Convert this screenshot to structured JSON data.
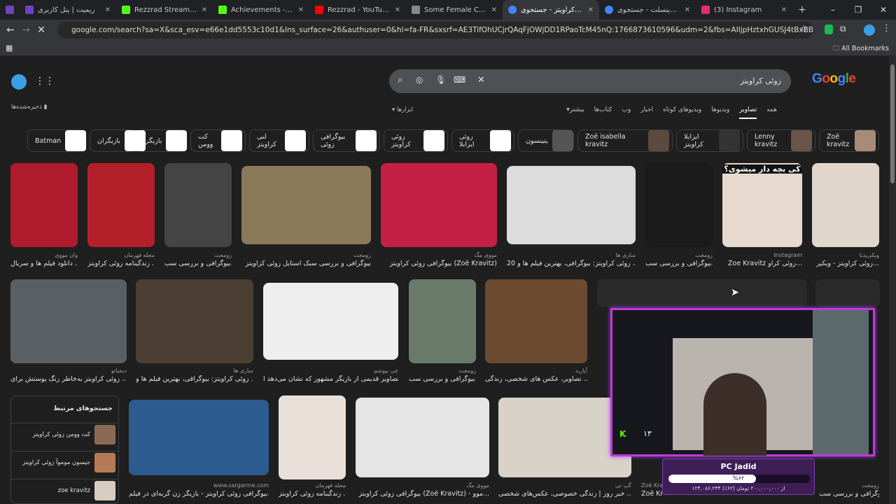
{
  "browser": {
    "tabs": [
      {
        "title": "ریمیت | پنل کاربری",
        "color": "#6f42c1",
        "active": false
      },
      {
        "title": "Rezzrad Stream - Watch L",
        "color": "#53fc18",
        "active": false
      },
      {
        "title": "Achievements - Kick Dash",
        "color": "#53fc18",
        "active": false
      },
      {
        "title": "Rezzrad - YouTube",
        "color": "#ff0000",
        "active": false
      },
      {
        "title": "Some Female Celebs",
        "color": "#888888",
        "active": false
      },
      {
        "title": "زوئی کراویتز - جستجوی",
        "color": "#4285f4",
        "active": true
      },
      {
        "title": "گیت وینسلت - جستجوی",
        "color": "#4285f4",
        "active": false
      },
      {
        "title": "(3) Instagram",
        "color": "#e1306c",
        "active": false
      }
    ],
    "url": "google.com/search?sa=X&sca_esv=e66e1dd5553c10d1&lns_surface=26&authuser=0&hl=fa-FR&sxsrf=AE3TifOhUCjrQAqFjOWjDD1RPaoTcM45nQ:1766873610596&udm=2&fbs=AIIjpHztxhGUSJ4tBxBBheto-n1E44pBQcgqJZ1QfmU35MdQxb2mHW...",
    "all_bookmarks": "All Bookmarks"
  },
  "search": {
    "query": "زوئی کراویتز"
  },
  "saved_label": "ذخیره‌شده‌ها",
  "tools_label": "ابزارها",
  "filters": [
    "همه",
    "تصاویر",
    "ویدیوها",
    "ویدیوهای کوتاه",
    "اخبار",
    "وب",
    "کتاب‌ها",
    "بیشتر"
  ],
  "chips": [
    "Zoë kravitz",
    "Lenny kravitz",
    "ایزابلا کراویتز",
    "Zoë isabella kravitz",
    "پتینسون",
    "زوئی ایزابلا",
    "زوئی کراویتز",
    "بیوگرافی زوئی",
    "لنی کراویتز",
    "کت وومن",
    "بازیگر",
    "بازیگران",
    "Batman"
  ],
  "row1": [
    {
      "cap": "دانلود فیلم ها و سریال ...",
      "src": "وان مووی",
      "color": "#b01b2e"
    },
    {
      "cap": "زندگینامه زوئی کراویتز ...",
      "src": "مجله فهرمان",
      "color": "#b3202a"
    },
    {
      "cap": "بیوگرافی و بررسی سب...",
      "src": "زومجت",
      "color": "#444"
    },
    {
      "cap": "بیوگرافی و بررسی سبک استایل زوئی کراویتز",
      "src": "زومجت",
      "color": "#8a7a5a"
    },
    {
      "cap": "بیوگرافی زوئی کراویتز (Zoë Kravitz)",
      "src": "مووی مگ",
      "color": "#c41f45"
    },
    {
      "cap": "زوئی کراویتز: بیوگرافی، بهترین فیلم ها و 20 ...",
      "src": "ساری ها",
      "color": "#dcdcdc"
    },
    {
      "cap": "بیوگرافی و بررسی سب...",
      "src": "زومجت",
      "color": "#1a1a1a"
    },
    {
      "cap": "Zoe Kravitz زوئی کراو...",
      "src": "Instagram",
      "color": "#e8d9cf"
    },
    {
      "cap": "زوئی کراویتز - ویکیر...",
      "src": "ویکی‌پدیا",
      "color": "#e0d6cc"
    }
  ],
  "overlay_text": "کی بچه دار میشوی؟",
  "row2": [
    {
      "cap": "زوئی کراویتز به‌خاطر رنگ پوستش برای ...",
      "src": "دیجیاتو",
      "color": "#5a5f63"
    },
    {
      "cap": "زوئی کراویتز: بیوگرافی، بهترین فیلم ها و ...",
      "src": "ساری ها",
      "color": "#4a3f32"
    },
    {
      "cap": "تصاویر قدیمی از بازیگر مشهور که نشان می‌دهد ا...",
      "src": "چی بپوشم",
      "color": "#eeeeee"
    },
    {
      "cap": "بیوگرافی و بررسی سب...",
      "src": "زومجت",
      "color": "#6a7a6a"
    },
    {
      "cap": "تصاویر، عکس های شخصی، زندگی ...",
      "src": "آپارید",
      "color": "#6b4a2f"
    },
    {
      "cap": "",
      "src": "",
      "color": "#2a2a2a"
    }
  ],
  "related": {
    "title": "جستجوهای مرتبط",
    "items": [
      "کت وومن زوئی کراویتز",
      "جیسون موموآ زوئی کراویتز",
      "zoe kravitz"
    ]
  },
  "row3": [
    {
      "cap": "بیوگرافی زوئی کراویتز - بازیگر زن گربه‌ای در فیلم...",
      "src": "www.sargarme.com",
      "color": "#2b5b8f"
    },
    {
      "cap": "زندگینامه زوئی کراویتز ...",
      "src": "مجله فهرمان",
      "color": "#e8e0d8"
    },
    {
      "cap": "بیوگرافی زوئی کراویتز (Zoë Kravitz) - موو...",
      "src": "مووی مگ",
      "color": "#e5e5e5"
    },
    {
      "cap": "خبر روز | زندگی خصوصی، عکس‌های شخصی ...",
      "src": "گپ تی",
      "color": "#d9d2c8"
    },
    {
      "cap": "Zoë Kra...",
      "src": "Zoë Kra",
      "color": "#444"
    },
    {
      "cap": "بیوگرافی و بررسی سب...",
      "src": "زومجت",
      "color": "#555"
    }
  ],
  "stream": {
    "name": "PC Jadid",
    "percent": "%۶۲",
    "progress": 0.62,
    "detail": "۱۲۴,۰۸۶,۲۳۴ از ۲۰۰,۰۰۰,۰۰۰ تومان (۶۲٪)",
    "counter": "۱۳"
  }
}
